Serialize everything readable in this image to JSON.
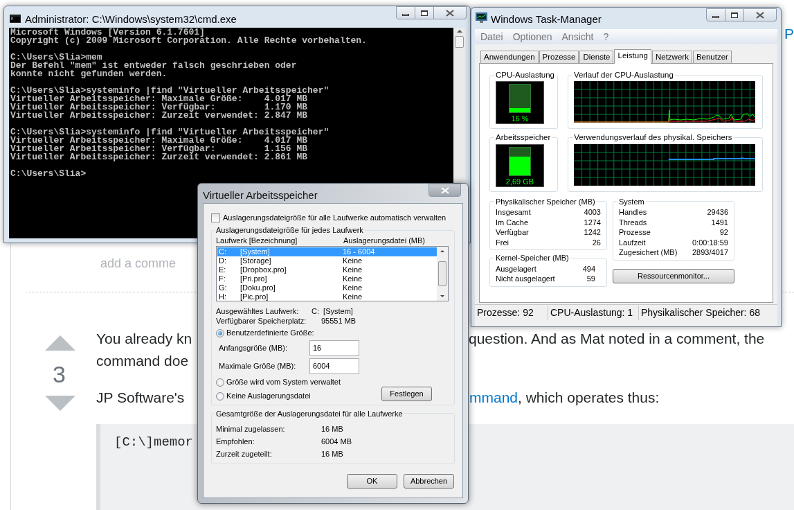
{
  "page": {
    "add_comment": "add a comme",
    "vote_count": "3",
    "fragments": [
      {
        "kind": "text",
        "text": "You already kn"
      },
      {
        "kind": "text",
        "text": "question. And as Mat noted in a comment, the"
      },
      {
        "kind": "text",
        "text": "command doe"
      },
      {
        "kind": "text",
        "text": "JP Software's"
      },
      {
        "kind": "link",
        "text": "mmand"
      },
      {
        "kind": "text",
        "text": ", which operates thus:"
      }
    ],
    "code": "[C:\\]memor",
    "edge_link": "P"
  },
  "cmd_window": {
    "title": "Administrator: C:\\Windows\\system32\\cmd.exe",
    "console_blocks": [
      [
        "Microsoft Windows [Version 6.1.7601]",
        "Copyright (c) 2009 Microsoft Corporation. Alle Rechte vorbehalten."
      ],
      [
        "C:\\Users\\Slia>mem",
        "Der Befehl \"mem\" ist entweder falsch geschrieben oder",
        "konnte nicht gefunden werden."
      ],
      [
        "C:\\Users\\Slia>systeminfo |find \"Virtueller Arbeitsspeicher\"",
        "Virtueller Arbeitsspeicher: Maximale Größe:    4.017 MB",
        "Virtueller Arbeitsspeicher: Verfügbar:         1.170 MB",
        "Virtueller Arbeitsspeicher: Zurzeit verwendet: 2.847 MB"
      ],
      [
        "C:\\Users\\Slia>systeminfo |find \"Virtueller Arbeitsspeicher\"",
        "Virtueller Arbeitsspeicher: Maximale Größe:    4.017 MB",
        "Virtueller Arbeitsspeicher: Verfügbar:         1.156 MB",
        "Virtueller Arbeitsspeicher: Zurzeit verwendet: 2.861 MB"
      ],
      [
        "C:\\Users\\Slia>"
      ]
    ]
  },
  "task_manager": {
    "title": "Windows Task-Manager",
    "menu": [
      "Datei",
      "Optionen",
      "Ansicht",
      "?"
    ],
    "tabs": [
      {
        "label": "Anwendungen",
        "selected": false
      },
      {
        "label": "Prozesse",
        "selected": false
      },
      {
        "label": "Dienste",
        "selected": false
      },
      {
        "label": "Leistung",
        "selected": true
      },
      {
        "label": "Netzwerk",
        "selected": false
      },
      {
        "label": "Benutzer",
        "selected": false
      }
    ],
    "cpu": {
      "title": "CPU-Auslastung",
      "reading": "16 %",
      "level": 0.16
    },
    "cpu_history": {
      "title": "Verlauf der CPU-Auslastung"
    },
    "memory": {
      "title": "Arbeitsspeicher",
      "reading": "2,69 GB",
      "level": 0.67
    },
    "memory_history": {
      "title": "Verwendungsverlauf des physikal. Speichers"
    },
    "physical": {
      "title": "Physikalischer Speicher (MB)",
      "rows": [
        {
          "label": "Insgesamt",
          "value": "4003"
        },
        {
          "label": "Im Cache",
          "value": "1274"
        },
        {
          "label": "Verfügbar",
          "value": "1242"
        },
        {
          "label": "Frei",
          "value": "26"
        }
      ]
    },
    "kernel": {
      "title": "Kernel-Speicher (MB)",
      "rows": [
        {
          "label": "Ausgelagert",
          "value": "494"
        },
        {
          "label": "Nicht ausgelagert",
          "value": "59"
        }
      ]
    },
    "system": {
      "title": "System",
      "rows": [
        {
          "label": "Handles",
          "value": "29436"
        },
        {
          "label": "Threads",
          "value": "1491"
        },
        {
          "label": "Prozesse",
          "value": "92"
        },
        {
          "label": "Laufzeit",
          "value": "0:00:18:59"
        },
        {
          "label": "Zugesichert (MB)",
          "value": "2893/4017"
        }
      ]
    },
    "monitor_button": "Ressourcenmonitor...",
    "status_bar": [
      "Prozesse: 92",
      "CPU-Auslastung: 1",
      "Physikalischer Speicher: 68"
    ]
  },
  "dialog": {
    "title": "Virtueller Arbeitsspeicher",
    "auto_manage": {
      "label": "Auslagerungsdateigröße für alle Laufwerke automatisch verwalten",
      "checked": false
    },
    "drives_group": {
      "title": "Auslagerungsdateigröße für jedes Laufwerk",
      "columns": [
        "Laufwerk [Bezeichnung]",
        "Auslagerungsdatei (MB)"
      ],
      "drives": [
        {
          "letter": "C:",
          "label": "[System]",
          "size": "16 - 6004",
          "selected": true
        },
        {
          "letter": "D:",
          "label": "[Storage]",
          "size": "Keine",
          "selected": false
        },
        {
          "letter": "E:",
          "label": "[Dropbox.pro]",
          "size": "Keine",
          "selected": false
        },
        {
          "letter": "F:",
          "label": "[Pri.pro]",
          "size": "Keine",
          "selected": false
        },
        {
          "letter": "G:",
          "label": "[Doku.pro]",
          "size": "Keine",
          "selected": false
        },
        {
          "letter": "H:",
          "label": "[Pic.pro]",
          "size": "Keine",
          "selected": false
        }
      ],
      "info": [
        {
          "label": "Ausgewähltes Laufwerk:",
          "value": "C:  [System]"
        },
        {
          "label": "Verfügbarer Speicherplatz:",
          "value": "95551 MB"
        }
      ],
      "custom": {
        "label": "Benutzerdefinierte Größe:",
        "selected": true
      },
      "fields": [
        {
          "label": "Anfangsgröße (MB):",
          "value": "16"
        },
        {
          "label": "Maximale Größe (MB):",
          "value": "6004"
        }
      ],
      "options": [
        {
          "label": "Größe wird vom System verwaltet",
          "selected": false
        },
        {
          "label": "Keine Auslagerungsdatei",
          "selected": false
        }
      ],
      "set_button": "Festlegen"
    },
    "totals_group": {
      "title": "Gesamtgröße der Auslagerungsdatei für alle Laufwerke",
      "rows": [
        {
          "label": "Minimal zugelassen:",
          "value": "16 MB"
        },
        {
          "label": "Empfohlen:",
          "value": "6004 MB"
        },
        {
          "label": "Zurzeit zugeteilt:",
          "value": "16 MB"
        }
      ]
    },
    "buttons": [
      "OK",
      "Abbrechen"
    ]
  }
}
